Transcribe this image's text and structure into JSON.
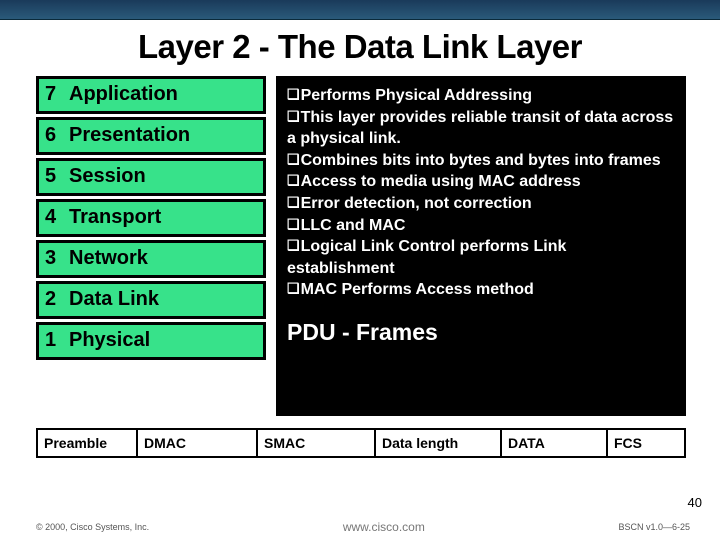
{
  "title": "Layer 2 - The Data Link Layer",
  "layers": [
    {
      "num": "7",
      "name": "Application"
    },
    {
      "num": "6",
      "name": "Presentation"
    },
    {
      "num": "5",
      "name": "Session"
    },
    {
      "num": "4",
      "name": "Transport"
    },
    {
      "num": "3",
      "name": "Network"
    },
    {
      "num": "2",
      "name": "Data Link"
    },
    {
      "num": "1",
      "name": "Physical"
    }
  ],
  "bullets": [
    "Performs Physical Addressing",
    "This layer provides reliable transit of data across a physical link.",
    "Combines bits into bytes and bytes into frames",
    "Access to media using MAC address",
    "Error detection, not correction",
    "LLC and MAC",
    "Logical Link Control performs Link establishment",
    "MAC Performs Access method"
  ],
  "pdu": "PDU - Frames",
  "frame": {
    "preamble": "Preamble",
    "dmac": "DMAC",
    "smac": "SMAC",
    "len": "Data length",
    "data": "DATA",
    "fcs": "FCS"
  },
  "footer": {
    "left": "© 2000, Cisco Systems, Inc.",
    "mid": "www.cisco.com",
    "right": "BSCN v1.0—6-25"
  },
  "pagenum": "40"
}
